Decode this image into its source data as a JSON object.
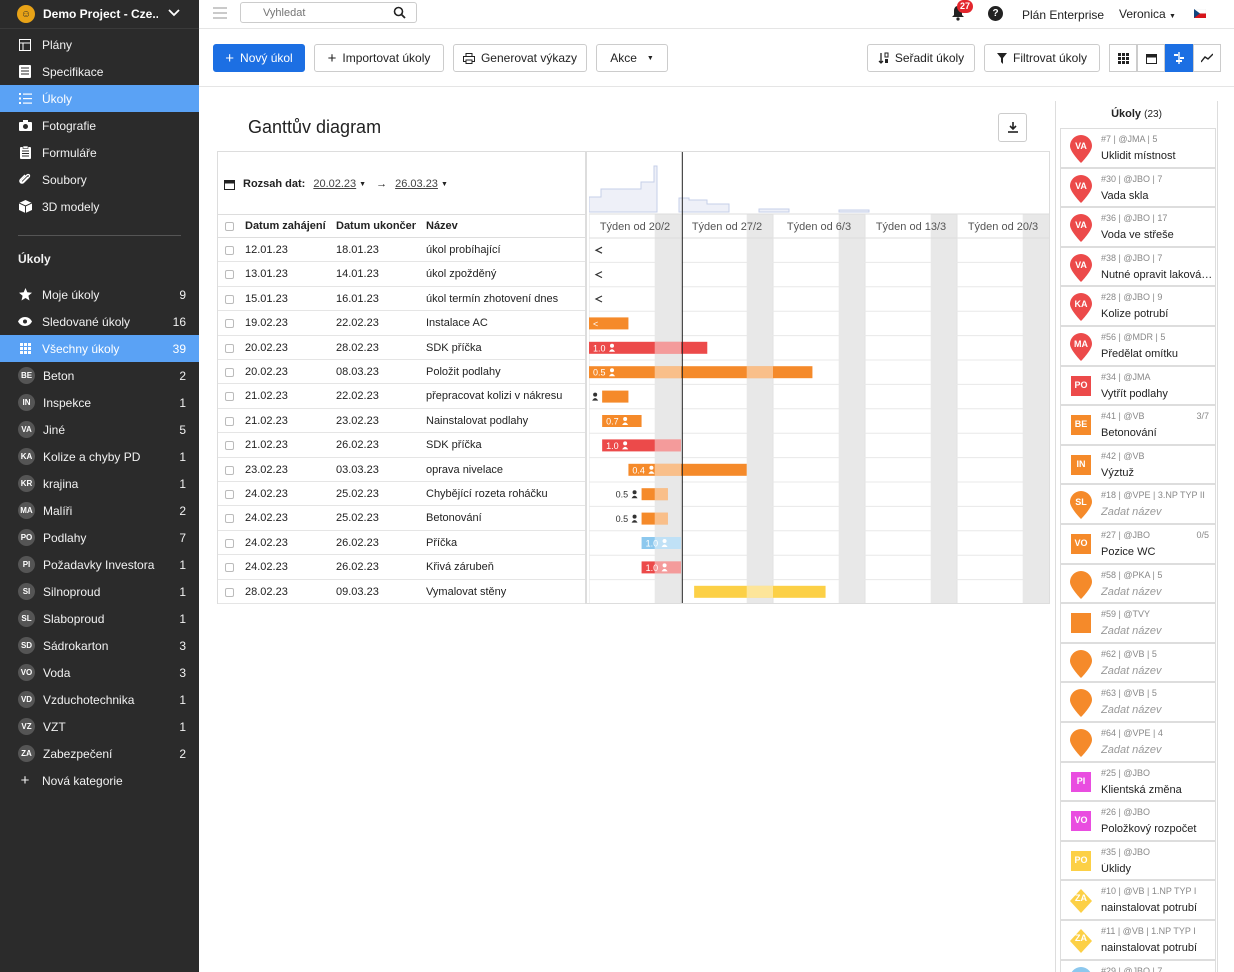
{
  "project": {
    "name": "Demo Project - Cze..."
  },
  "sidebar": {
    "nav": [
      {
        "label": "Plány",
        "icon": "plans-icon"
      },
      {
        "label": "Specifikace",
        "icon": "specification-icon"
      },
      {
        "label": "Úkoly",
        "icon": "list-icon",
        "active": true
      },
      {
        "label": "Fotografie",
        "icon": "camera-icon"
      },
      {
        "label": "Formuláře",
        "icon": "form-icon"
      },
      {
        "label": "Soubory",
        "icon": "paperclip-icon"
      },
      {
        "label": "3D modely",
        "icon": "cube-icon"
      }
    ],
    "section_title": "Úkoly",
    "tasks": [
      {
        "label": "Moje úkoly",
        "count": "9",
        "icon": "star-icon"
      },
      {
        "label": "Sledované úkoly",
        "count": "16",
        "icon": "eye-icon"
      },
      {
        "label": "Všechny úkoly",
        "count": "39",
        "icon": "grid-icon",
        "active": true
      },
      {
        "label": "Beton",
        "count": "2",
        "badge": "BE"
      },
      {
        "label": "Inspekce",
        "count": "1",
        "badge": "IN"
      },
      {
        "label": "Jiné",
        "count": "5",
        "badge": "VA"
      },
      {
        "label": "Kolize a chyby PD",
        "count": "1",
        "badge": "KA"
      },
      {
        "label": "krajina",
        "count": "1",
        "badge": "KR"
      },
      {
        "label": "Malíři",
        "count": "2",
        "badge": "MA"
      },
      {
        "label": "Podlahy",
        "count": "7",
        "badge": "PO"
      },
      {
        "label": "Požadavky Investora",
        "count": "1",
        "badge": "PI"
      },
      {
        "label": "Silnoproud",
        "count": "1",
        "badge": "SI"
      },
      {
        "label": "Slaboproud",
        "count": "1",
        "badge": "SL"
      },
      {
        "label": "Sádrokarton",
        "count": "3",
        "badge": "SD"
      },
      {
        "label": "Voda",
        "count": "3",
        "badge": "VO"
      },
      {
        "label": "Vzduchotechnika",
        "count": "1",
        "badge": "VD"
      },
      {
        "label": "VZT",
        "count": "1",
        "badge": "VZ"
      },
      {
        "label": "Zabezpečení",
        "count": "2",
        "badge": "ZA"
      }
    ],
    "new_category": "Nová kategorie"
  },
  "topbar": {
    "search_placeholder": "Vyhledat",
    "notifications": "27",
    "help": "?",
    "plan": "Plán Enterprise",
    "user": "Veronica"
  },
  "toolbar": {
    "new_task": "Nový úkol",
    "import": "Importovat úkoly",
    "reports": "Generovat výkazy",
    "actions": "Akce",
    "sort": "Seřadit úkoly",
    "filter": "Filtrovat úkoly"
  },
  "gantt": {
    "title": "Ganttův diagram",
    "range_label": "Rozsah dat:",
    "range_from": "20.02.23",
    "range_to": "26.03.23",
    "columns": [
      "Datum zahájení",
      "Datum ukončení",
      "Název"
    ],
    "weeks": [
      "Týden od 20/2",
      "Týden od 27/2",
      "Týden od 6/3",
      "Týden od 13/3",
      "Týden od 20/3"
    ],
    "rows": [
      {
        "start": "12.01.23",
        "end": "18.01.23",
        "name": "úkol probíhající",
        "color": "",
        "label": "",
        "out_of_range": true
      },
      {
        "start": "13.01.23",
        "end": "14.01.23",
        "name": "úkol zpožděný",
        "color": "",
        "label": "",
        "out_of_range": true
      },
      {
        "start": "15.01.23",
        "end": "16.01.23",
        "name": "úkol termín zhotovení dnes",
        "color": "",
        "label": "",
        "out_of_range": true
      },
      {
        "start": "19.02.23",
        "end": "22.02.23",
        "name": "Instalace AC",
        "color": "#f58a2a",
        "label": "<"
      },
      {
        "start": "20.02.23",
        "end": "28.02.23",
        "name": "SDK příčka",
        "color": "#ec4a4a",
        "label": "1.0"
      },
      {
        "start": "20.02.23",
        "end": "08.03.23",
        "name": "Položit podlahy",
        "color": "#f58a2a",
        "label": "0.5"
      },
      {
        "start": "21.02.23",
        "end": "22.02.23",
        "name": "přepracovat kolizi v nákresu",
        "color": "#f58a2a",
        "label": "0.2"
      },
      {
        "start": "21.02.23",
        "end": "23.02.23",
        "name": "Nainstalovat podlahy",
        "color": "#f58a2a",
        "label": "0.7"
      },
      {
        "start": "21.02.23",
        "end": "26.02.23",
        "name": "SDK příčka",
        "color": "#ec4a4a",
        "label": "1.0"
      },
      {
        "start": "23.02.23",
        "end": "03.03.23",
        "name": "oprava nivelace",
        "color": "#f58a2a",
        "label": "0.4"
      },
      {
        "start": "24.02.23",
        "end": "25.02.23",
        "name": "Chybějící rozeta roháčku",
        "color": "#f58a2a",
        "label": "0.5"
      },
      {
        "start": "24.02.23",
        "end": "25.02.23",
        "name": "Betonování",
        "color": "#f58a2a",
        "label": "0.5"
      },
      {
        "start": "24.02.23",
        "end": "26.02.23",
        "name": "Příčka",
        "color": "#8cc8ee",
        "label": "1.0"
      },
      {
        "start": "24.02.23",
        "end": "26.02.23",
        "name": "Křivá zárubeň",
        "color": "#ec4a4a",
        "label": "1.0"
      },
      {
        "start": "28.02.23",
        "end": "09.03.23",
        "name": "Vymalovat stěny",
        "color": "#fcd046",
        "label": ""
      }
    ]
  },
  "tasks_panel": {
    "title": "Úkoly",
    "count": "(23)",
    "items": [
      {
        "meta": "#7 | @JMA | 5",
        "name": "Uklidit místnost",
        "badge": "VA",
        "color": "#ec4a4a",
        "shape": "pin"
      },
      {
        "meta": "#30 | @JBO | 7",
        "name": "Vada skla",
        "badge": "VA",
        "color": "#ec4a4a",
        "shape": "pin"
      },
      {
        "meta": "#36 | @JBO | 17",
        "name": "Voda ve střeše",
        "badge": "VA",
        "color": "#ec4a4a",
        "shape": "pin"
      },
      {
        "meta": "#38 | @JBO | 7",
        "name": "Nutné opravit laková…",
        "badge": "VA",
        "color": "#ec4a4a",
        "shape": "pin"
      },
      {
        "meta": "#28 | @JBO | 9",
        "name": "Kolize potrubí",
        "badge": "KA",
        "color": "#ec4a4a",
        "shape": "pin"
      },
      {
        "meta": "#56 | @MDR | 5",
        "name": "Předělat omítku",
        "badge": "MA",
        "color": "#ec4a4a",
        "shape": "pin"
      },
      {
        "meta": "#34 | @JMA",
        "name": "Vytřít podlahy",
        "badge": "PO",
        "color": "#ec4a4a",
        "shape": "square"
      },
      {
        "meta": "#41 | @VB",
        "name": "Betonování",
        "badge": "BE",
        "color": "#f58a2a",
        "shape": "square",
        "progress": "3/7"
      },
      {
        "meta": "#42 | @VB",
        "name": "Výztuž",
        "badge": "IN",
        "color": "#f58a2a",
        "shape": "square"
      },
      {
        "meta": "#18 | @VPE | 3.NP TYP II",
        "name": "Zadat název",
        "badge": "SL",
        "color": "#f58a2a",
        "shape": "pin",
        "placeholder": true
      },
      {
        "meta": "#27 | @JBO",
        "name": "Pozice WC",
        "badge": "VO",
        "color": "#f58a2a",
        "shape": "square",
        "progress": "0/5"
      },
      {
        "meta": "#58 | @PKA | 5",
        "name": "Zadat název",
        "badge": "",
        "color": "#f58a2a",
        "shape": "pin",
        "placeholder": true
      },
      {
        "meta": "#59 | @TVY",
        "name": "Zadat název",
        "badge": "",
        "color": "#f58a2a",
        "shape": "square",
        "placeholder": true
      },
      {
        "meta": "#62 | @VB | 5",
        "name": "Zadat název",
        "badge": "",
        "color": "#f58a2a",
        "shape": "pin",
        "placeholder": true
      },
      {
        "meta": "#63 | @VB | 5",
        "name": "Zadat název",
        "badge": "",
        "color": "#f58a2a",
        "shape": "pin",
        "placeholder": true
      },
      {
        "meta": "#64 | @VPE | 4",
        "name": "Zadat název",
        "badge": "",
        "color": "#f58a2a",
        "shape": "pin",
        "placeholder": true
      },
      {
        "meta": "#25 | @JBO",
        "name": "Klientská změna",
        "badge": "PI",
        "color": "#e94de0",
        "shape": "square"
      },
      {
        "meta": "#26 | @JBO",
        "name": "Položkový rozpočet",
        "badge": "VO",
        "color": "#e94de0",
        "shape": "square"
      },
      {
        "meta": "#35 | @JBO",
        "name": "Úklidy",
        "badge": "PO",
        "color": "#fcd046",
        "shape": "square"
      },
      {
        "meta": "#10 | @VB | 1.NP TYP I",
        "name": "nainstalovat potrubí",
        "badge": "ZA",
        "color": "#fcd046",
        "shape": "diamond"
      },
      {
        "meta": "#11 | @VB | 1.NP TYP I",
        "name": "nainstalovat potrubí",
        "badge": "ZA",
        "color": "#fcd046",
        "shape": "diamond"
      },
      {
        "meta": "#29 | @JBO | 7",
        "name": "",
        "badge": "",
        "color": "#8cc8ee",
        "shape": "pin"
      }
    ]
  }
}
